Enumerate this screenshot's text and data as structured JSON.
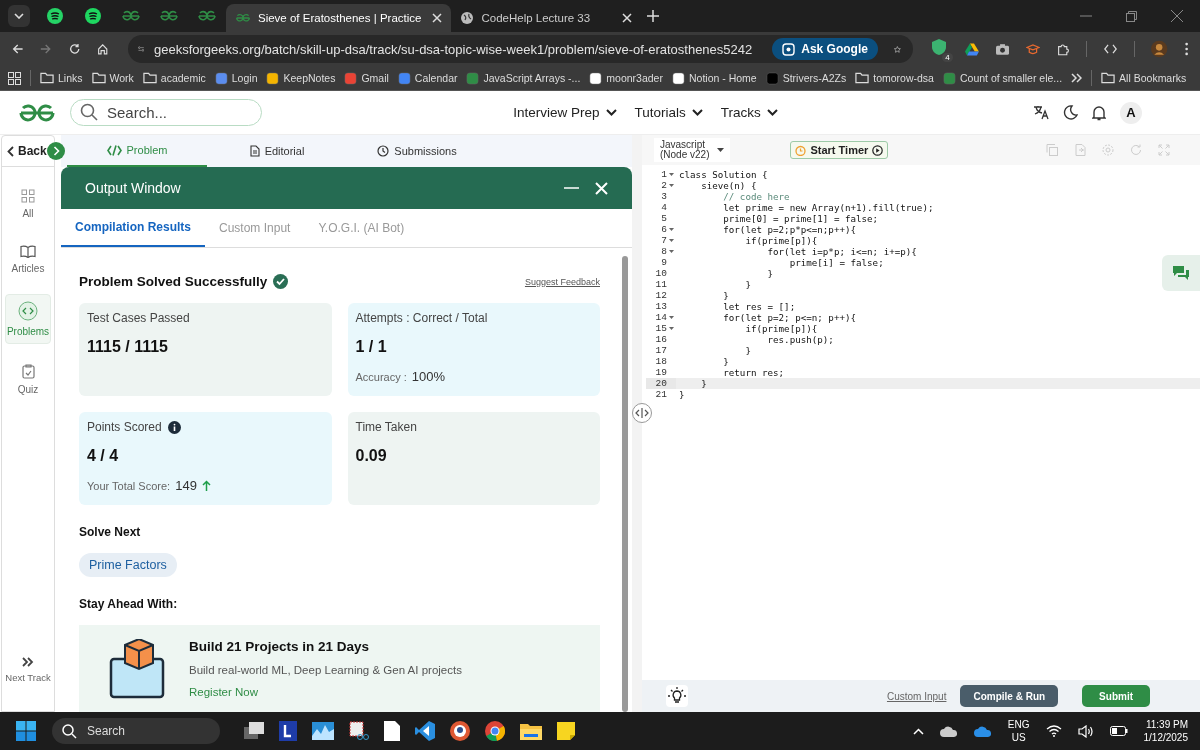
{
  "browser": {
    "tabs": [
      {
        "kind": "pinned",
        "selected": false
      },
      {
        "kind": "pinned",
        "selected": false
      },
      {
        "kind": "pinned",
        "selected": false
      },
      {
        "kind": "pinned",
        "selected": false
      },
      {
        "kind": "pinned",
        "selected": false
      },
      {
        "kind": "page",
        "title": "Sieve of Eratosthenes | Practice",
        "selected": true
      },
      {
        "kind": "page",
        "title": "CodeHelp Lecture 33",
        "selected": false
      }
    ],
    "url": "geeksforgeeks.org/batch/skill-up-dsa/track/su-dsa-topic-wise-week1/problem/sieve-of-eratosthenes5242",
    "ask_button": "Ask Google",
    "extension_badge": "4",
    "bookmarks": [
      {
        "kind": "folder",
        "label": "Links"
      },
      {
        "kind": "folder",
        "label": "Work"
      },
      {
        "kind": "folder",
        "label": "academic"
      },
      {
        "kind": "site",
        "label": "Login"
      },
      {
        "kind": "site",
        "label": "KeepNotes"
      },
      {
        "kind": "site",
        "label": "Gmail"
      },
      {
        "kind": "site",
        "label": "Calendar"
      },
      {
        "kind": "site",
        "label": "JavaScript Arrays -..."
      },
      {
        "kind": "site",
        "label": "moonr3ader"
      },
      {
        "kind": "site",
        "label": "Notion - Home"
      },
      {
        "kind": "site",
        "label": "Strivers-A2Zs"
      },
      {
        "kind": "folder",
        "label": "tomorow-dsa"
      },
      {
        "kind": "site",
        "label": "Count of smaller ele..."
      }
    ],
    "all_bookmarks": "All Bookmarks"
  },
  "site": {
    "search_placeholder": "Search...",
    "nav": [
      "Interview Prep",
      "Tutorials",
      "Tracks"
    ],
    "avatar": "A"
  },
  "sidebar": {
    "back": "Back",
    "items": [
      {
        "label": "All",
        "selected": false
      },
      {
        "label": "Articles",
        "selected": false
      },
      {
        "label": "Problems",
        "selected": true
      },
      {
        "label": "Quiz",
        "selected": false
      }
    ],
    "next_track": "Next Track"
  },
  "problem_tabs": [
    {
      "label": "Problem",
      "selected": true
    },
    {
      "label": "Editorial",
      "selected": false
    },
    {
      "label": "Submissions",
      "selected": false
    }
  ],
  "output_window": {
    "title": "Output Window",
    "tabs": [
      {
        "label": "Compilation Results",
        "selected": true
      },
      {
        "label": "Custom Input",
        "selected": false
      },
      {
        "label": "Y.O.G.I. (AI Bot)",
        "selected": false
      }
    ],
    "status": "Problem Solved Successfully",
    "feedback": "Suggest Feedback",
    "cards": [
      {
        "label": "Test Cases Passed",
        "value": "1115 / 1115",
        "color": "#eef4f2",
        "info": false
      },
      {
        "label": "Attempts : Correct / Total",
        "value": "1 / 1",
        "note_label": "Accuracy :",
        "note_value": "100%",
        "color": "#e9f8fc",
        "info": false
      },
      {
        "label": "Points Scored",
        "value": "4 / 4",
        "note_label": "Your Total Score:",
        "note_value": "149",
        "trend_up": true,
        "color": "#e9f8fc",
        "info": true
      },
      {
        "label": "Time Taken",
        "value": "0.09",
        "color": "#eef4f2",
        "info": false
      }
    ],
    "solve_next": "Solve Next",
    "chips": [
      "Prime Factors"
    ],
    "stay_ahead": "Stay Ahead With:",
    "promo": {
      "title": "Build 21 Projects in 21 Days",
      "text": "Build real-world ML, Deep Learning & Gen AI projects",
      "link": "Register Now"
    }
  },
  "editor": {
    "language": [
      "Javascript",
      "(Node v22)"
    ],
    "timer": "Start Timer",
    "lines": [
      {
        "no": "1",
        "text": "class Solution {",
        "fold": true,
        "kind": "code",
        "active": false
      },
      {
        "no": "2",
        "text": "    sieve(n) {",
        "fold": true,
        "kind": "code",
        "active": false
      },
      {
        "no": "3",
        "text": "        // code here",
        "fold": false,
        "kind": "comment",
        "active": false
      },
      {
        "no": "4",
        "text": "        let prime = new Array(n+1).fill(true);",
        "fold": false,
        "kind": "code",
        "active": false
      },
      {
        "no": "5",
        "text": "        prime[0] = prime[1] = false;",
        "fold": false,
        "kind": "code",
        "active": false
      },
      {
        "no": "6",
        "text": "        for(let p=2;p*p<=n;p++){",
        "fold": true,
        "kind": "code",
        "active": false
      },
      {
        "no": "7",
        "text": "            if(prime[p]){",
        "fold": true,
        "kind": "code",
        "active": false
      },
      {
        "no": "8",
        "text": "                for(let i=p*p; i<=n; i+=p){",
        "fold": true,
        "kind": "code",
        "active": false
      },
      {
        "no": "9",
        "text": "                    prime[i] = false;",
        "fold": false,
        "kind": "code",
        "active": false
      },
      {
        "no": "10",
        "text": "                }",
        "fold": false,
        "kind": "code",
        "active": false
      },
      {
        "no": "11",
        "text": "            }",
        "fold": false,
        "kind": "code",
        "active": false
      },
      {
        "no": "12",
        "text": "        }",
        "fold": false,
        "kind": "code",
        "active": false
      },
      {
        "no": "13",
        "text": "        let res = [];",
        "fold": false,
        "kind": "code",
        "active": false
      },
      {
        "no": "14",
        "text": "        for(let p=2; p<=n; p++){",
        "fold": true,
        "kind": "code",
        "active": false
      },
      {
        "no": "15",
        "text": "            if(prime[p]){",
        "fold": true,
        "kind": "code",
        "active": false
      },
      {
        "no": "16",
        "text": "                res.push(p);",
        "fold": false,
        "kind": "code",
        "active": false
      },
      {
        "no": "17",
        "text": "            }",
        "fold": false,
        "kind": "code",
        "active": false
      },
      {
        "no": "18",
        "text": "        }",
        "fold": false,
        "kind": "code",
        "active": false
      },
      {
        "no": "19",
        "text": "        return res;",
        "fold": false,
        "kind": "code",
        "active": false
      },
      {
        "no": "20",
        "text": "    }",
        "fold": false,
        "kind": "code",
        "active": true
      },
      {
        "no": "21",
        "text": "}",
        "fold": false,
        "kind": "code",
        "active": false
      }
    ],
    "custom_input": "Custom Input",
    "compile": "Compile & Run",
    "submit": "Submit"
  },
  "taskbar": {
    "search": "Search",
    "lang": [
      "ENG",
      "US"
    ],
    "time": "11:39 PM",
    "date": "1/12/2025"
  }
}
